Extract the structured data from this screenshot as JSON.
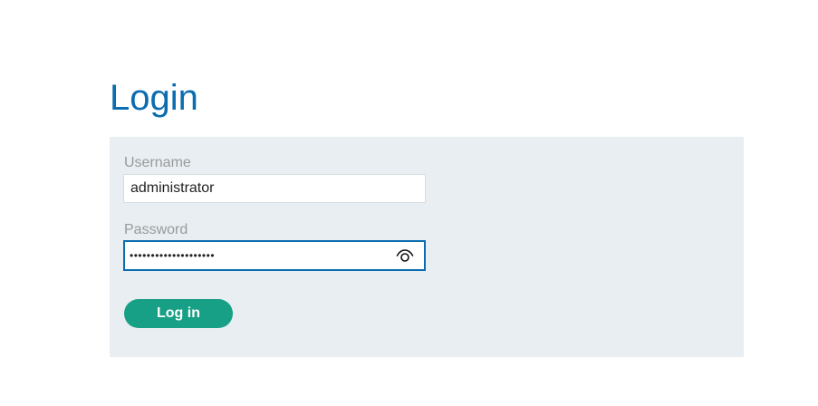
{
  "page": {
    "title": "Login"
  },
  "form": {
    "username": {
      "label": "Username",
      "value": "administrator"
    },
    "password": {
      "label": "Password",
      "masked_value": "••••••••••••••••••••",
      "toggle_icon": "eye-icon"
    },
    "submit_label": "Log in"
  },
  "colors": {
    "title": "#0b6db0",
    "panel_background": "#e8eef1",
    "focus_border": "#0b6db0",
    "button_background": "#17a085",
    "button_text": "#ffffff"
  }
}
